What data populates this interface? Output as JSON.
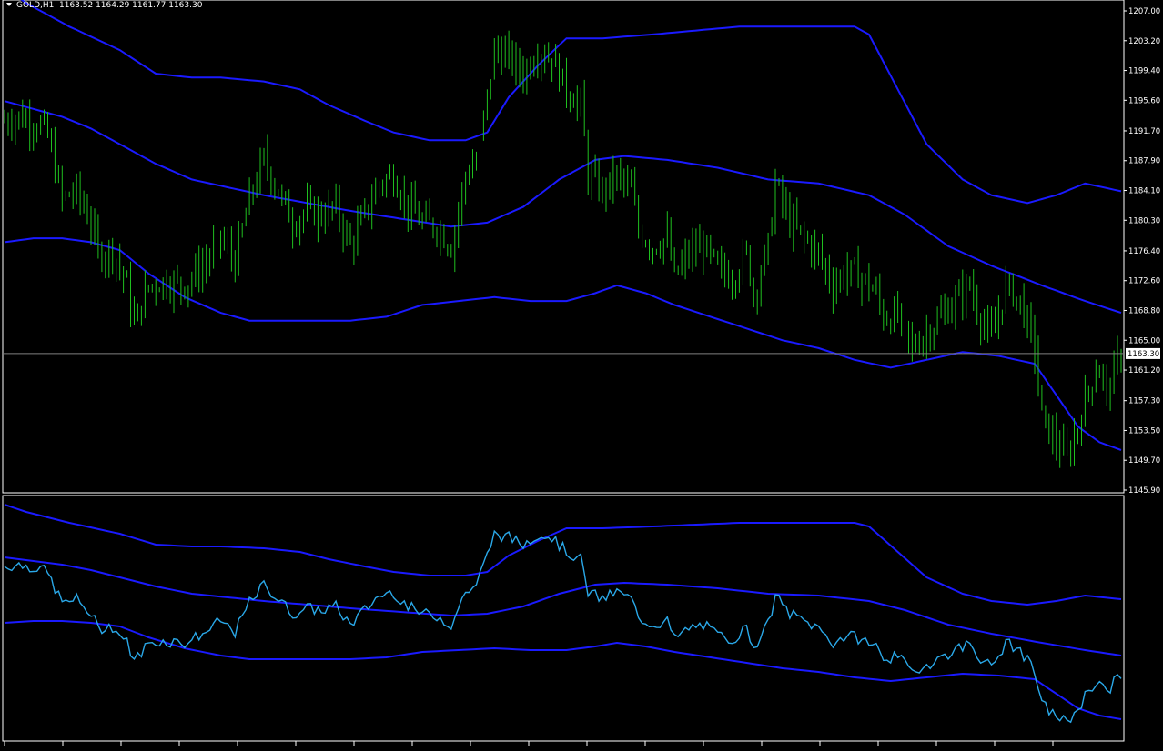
{
  "header": {
    "symbol_label": "GOLD,H1",
    "ohlc_label": "1163.52 1164.29 1161.77 1163.30"
  },
  "colors": {
    "background": "#000000",
    "candle": "#1fbf1f",
    "band": "#1a1aff",
    "indicator_line": "#2aa8e8",
    "grid_border": "#ffffff",
    "current_line": "#7f7f7f",
    "current_label_bg": "#ffffff"
  },
  "chart_data": {
    "type": "line",
    "title": "GOLD,H1",
    "bar_count": 300,
    "current_price": 1163.3,
    "current_price_label": "1163.30",
    "y_ticks": [
      {
        "value": 1207.0,
        "label": "1207.00"
      },
      {
        "value": 1203.2,
        "label": "1203.20"
      },
      {
        "value": 1199.4,
        "label": "1199.40"
      },
      {
        "value": 1195.6,
        "label": "1195.60"
      },
      {
        "value": 1191.7,
        "label": "1191.70"
      },
      {
        "value": 1187.9,
        "label": "1187.90"
      },
      {
        "value": 1184.1,
        "label": "1184.10"
      },
      {
        "value": 1180.3,
        "label": "1180.30"
      },
      {
        "value": 1176.4,
        "label": "1176.40"
      },
      {
        "value": 1172.6,
        "label": "1172.60"
      },
      {
        "value": 1168.8,
        "label": "1168.80"
      },
      {
        "value": 1165.0,
        "label": "1165.00"
      },
      {
        "value": 1161.2,
        "label": "1161.20"
      },
      {
        "value": 1157.3,
        "label": "1157.30"
      },
      {
        "value": 1153.5,
        "label": "1153.50"
      },
      {
        "value": 1149.7,
        "label": "1149.70"
      },
      {
        "value": 1145.9,
        "label": "1145.90"
      }
    ],
    "ylim": [
      1145.1,
      1208.2
    ],
    "price_keys": [
      [
        0,
        1193
      ],
      [
        4,
        1193.5
      ],
      [
        10,
        1192.5
      ],
      [
        12,
        1191
      ],
      [
        16,
        1183
      ],
      [
        20,
        1184
      ],
      [
        24,
        1180
      ],
      [
        26,
        1176
      ],
      [
        30,
        1176.5
      ],
      [
        34,
        1172
      ],
      [
        36,
        1167
      ],
      [
        40,
        1172
      ],
      [
        45,
        1172.5
      ],
      [
        50,
        1172
      ],
      [
        56,
        1175
      ],
      [
        60,
        1178
      ],
      [
        64,
        1175
      ],
      [
        68,
        1183
      ],
      [
        72,
        1188
      ],
      [
        76,
        1184
      ],
      [
        80,
        1180
      ],
      [
        84,
        1181.5
      ],
      [
        88,
        1181
      ],
      [
        92,
        1182
      ],
      [
        96,
        1177
      ],
      [
        100,
        1181
      ],
      [
        104,
        1185
      ],
      [
        108,
        1186
      ],
      [
        112,
        1182
      ],
      [
        116,
        1180
      ],
      [
        120,
        1179.5
      ],
      [
        124,
        1177
      ],
      [
        128,
        1186
      ],
      [
        131,
        1188
      ],
      [
        134,
        1196
      ],
      [
        136,
        1202
      ],
      [
        140,
        1201
      ],
      [
        144,
        1199
      ],
      [
        148,
        1202
      ],
      [
        152,
        1201
      ],
      [
        156,
        1197
      ],
      [
        160,
        1195
      ],
      [
        162,
        1186
      ],
      [
        166,
        1184
      ],
      [
        170,
        1186
      ],
      [
        174,
        1184
      ],
      [
        176,
        1179
      ],
      [
        180,
        1177
      ],
      [
        184,
        1178
      ],
      [
        186,
        1173
      ],
      [
        190,
        1176
      ],
      [
        194,
        1177
      ],
      [
        198,
        1174
      ],
      [
        202,
        1173
      ],
      [
        206,
        1176
      ],
      [
        208,
        1171
      ],
      [
        212,
        1177
      ],
      [
        214,
        1185
      ],
      [
        218,
        1180
      ],
      [
        222,
        1178
      ],
      [
        226,
        1176
      ],
      [
        230,
        1172
      ],
      [
        234,
        1174
      ],
      [
        238,
        1173
      ],
      [
        242,
        1171
      ],
      [
        244,
        1168
      ],
      [
        248,
        1168
      ],
      [
        252,
        1164
      ],
      [
        256,
        1166
      ],
      [
        260,
        1168
      ],
      [
        264,
        1170
      ],
      [
        268,
        1172
      ],
      [
        270,
        1169
      ],
      [
        274,
        1165
      ],
      [
        278,
        1172
      ],
      [
        282,
        1170
      ],
      [
        286,
        1164
      ],
      [
        288,
        1155
      ],
      [
        292,
        1152
      ],
      [
        295,
        1150
      ],
      [
        298,
        1154
      ],
      [
        301,
        1159
      ],
      [
        304,
        1162
      ],
      [
        306,
        1158
      ],
      [
        308,
        1161
      ],
      [
        310,
        1163.3
      ]
    ],
    "band_keys": {
      "upper": [
        [
          0,
          1210
        ],
        [
          6,
          1208
        ],
        [
          18,
          1205
        ],
        [
          32,
          1202
        ],
        [
          42,
          1199
        ],
        [
          52,
          1198.5
        ],
        [
          60,
          1198.5
        ],
        [
          72,
          1198
        ],
        [
          82,
          1197
        ],
        [
          90,
          1195
        ],
        [
          100,
          1193
        ],
        [
          108,
          1191.5
        ],
        [
          118,
          1190.5
        ],
        [
          128,
          1190.5
        ],
        [
          134,
          1191.5
        ],
        [
          140,
          1196
        ],
        [
          148,
          1200
        ],
        [
          156,
          1203.5
        ],
        [
          166,
          1203.5
        ],
        [
          180,
          1204
        ],
        [
          192,
          1204.5
        ],
        [
          204,
          1205
        ],
        [
          220,
          1205
        ],
        [
          236,
          1205
        ],
        [
          240,
          1204
        ],
        [
          248,
          1197
        ],
        [
          256,
          1190
        ],
        [
          266,
          1185.5
        ],
        [
          274,
          1183.5
        ],
        [
          284,
          1182.5
        ],
        [
          292,
          1183.5
        ],
        [
          300,
          1185
        ],
        [
          310,
          1184
        ]
      ],
      "middle": [
        [
          0,
          1195.5
        ],
        [
          8,
          1194.5
        ],
        [
          16,
          1193.5
        ],
        [
          24,
          1192
        ],
        [
          32,
          1190
        ],
        [
          42,
          1187.5
        ],
        [
          52,
          1185.5
        ],
        [
          62,
          1184.5
        ],
        [
          72,
          1183.5
        ],
        [
          84,
          1182.5
        ],
        [
          96,
          1181.5
        ],
        [
          110,
          1180.5
        ],
        [
          124,
          1179.5
        ],
        [
          134,
          1180
        ],
        [
          144,
          1182
        ],
        [
          154,
          1185.5
        ],
        [
          164,
          1188
        ],
        [
          172,
          1188.5
        ],
        [
          184,
          1188
        ],
        [
          198,
          1187
        ],
        [
          212,
          1185.5
        ],
        [
          226,
          1185
        ],
        [
          240,
          1183.5
        ],
        [
          250,
          1181
        ],
        [
          262,
          1177
        ],
        [
          274,
          1174.5
        ],
        [
          288,
          1172
        ],
        [
          300,
          1170
        ],
        [
          310,
          1168.5
        ]
      ],
      "lower": [
        [
          0,
          1177.5
        ],
        [
          8,
          1178
        ],
        [
          16,
          1178
        ],
        [
          24,
          1177.5
        ],
        [
          32,
          1176.5
        ],
        [
          40,
          1173.5
        ],
        [
          50,
          1170.5
        ],
        [
          60,
          1168.5
        ],
        [
          68,
          1167.5
        ],
        [
          76,
          1167.5
        ],
        [
          86,
          1167.5
        ],
        [
          96,
          1167.5
        ],
        [
          106,
          1168
        ],
        [
          116,
          1169.5
        ],
        [
          126,
          1170
        ],
        [
          136,
          1170.5
        ],
        [
          146,
          1170
        ],
        [
          156,
          1170
        ],
        [
          164,
          1171
        ],
        [
          170,
          1172
        ],
        [
          178,
          1171
        ],
        [
          186,
          1169.5
        ],
        [
          196,
          1168
        ],
        [
          206,
          1166.5
        ],
        [
          216,
          1165
        ],
        [
          226,
          1164
        ],
        [
          236,
          1162.5
        ],
        [
          246,
          1161.5
        ],
        [
          256,
          1162.5
        ],
        [
          266,
          1163.5
        ],
        [
          276,
          1163
        ],
        [
          286,
          1162
        ],
        [
          292,
          1158
        ],
        [
          298,
          1154
        ],
        [
          304,
          1152
        ],
        [
          310,
          1151
        ]
      ]
    },
    "x_tick_count": 19
  }
}
